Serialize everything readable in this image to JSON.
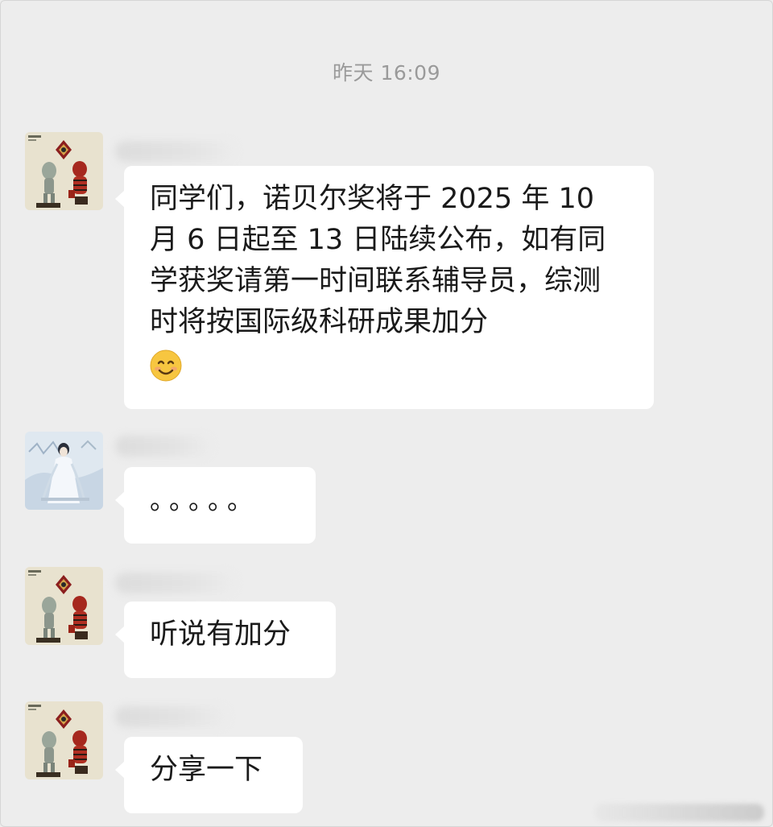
{
  "chat": {
    "timestamp": "昨天 16:09",
    "messages": [
      {
        "sender_avatar": "cartoon-figures-avatar",
        "text": "同学们，诺贝尔奖将于 2025 年 10 月 6 日起至 13 日陆续公布，如有同学获奖请第一时间联系辅导员，综测时将按国际级科研成果加分",
        "emoji": "smiling-face-emoji"
      },
      {
        "sender_avatar": "painted-figure-avatar",
        "text": "。。。。。"
      },
      {
        "sender_avatar": "cartoon-figures-avatar",
        "text": "听说有加分"
      },
      {
        "sender_avatar": "cartoon-figures-avatar",
        "text": "分享一下"
      }
    ]
  },
  "colors": {
    "background": "#ededed",
    "bubble": "#ffffff",
    "text": "#1a1a1a",
    "timestamp": "#9a9a9a"
  }
}
